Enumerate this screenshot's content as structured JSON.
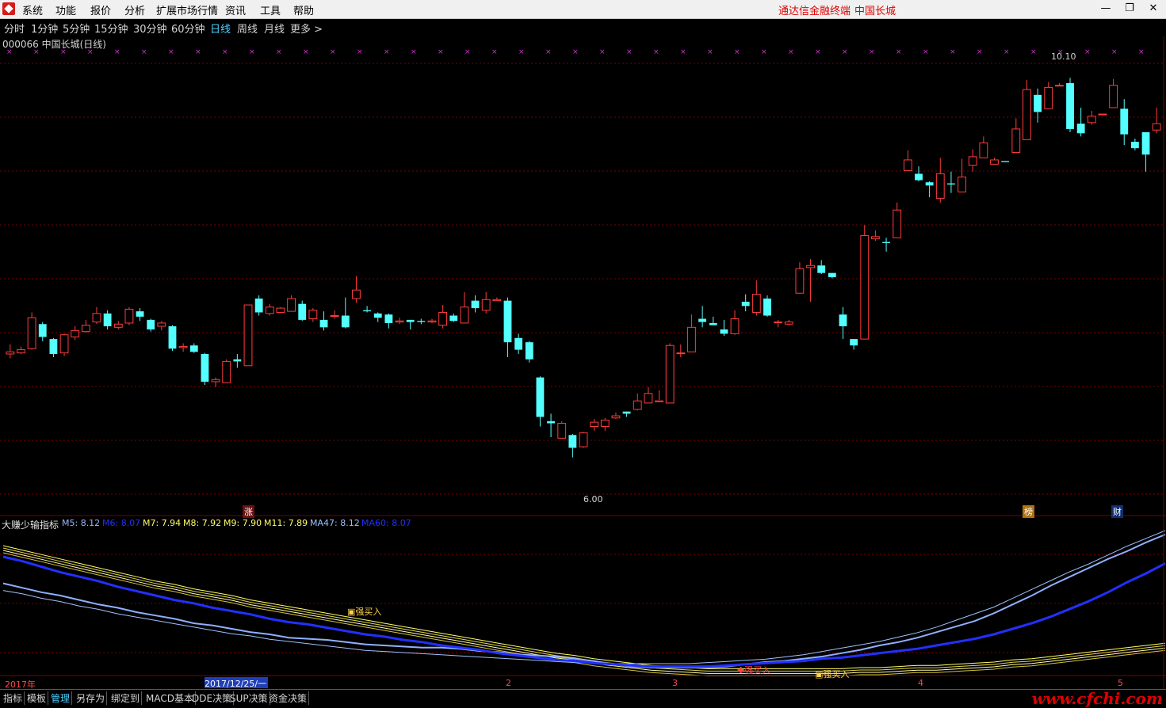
{
  "menu": {
    "items": [
      "系统",
      "功能",
      "报价",
      "分析",
      "扩展市场行情",
      "资讯",
      "工具",
      "帮助"
    ],
    "brand_left": "通达信金融终端",
    "brand_right": "中国长城"
  },
  "periods": [
    "分时",
    "1分钟",
    "5分钟",
    "15分钟",
    "30分钟",
    "60分钟",
    "日线",
    "周线",
    "月线",
    "更多 >"
  ],
  "active_period": "日线",
  "stock": {
    "title": "000066 中国长城(日线)",
    "high_label": "10.10",
    "low_label": "6.00",
    "zhang_tag": "涨",
    "bang_tag": "榜",
    "cai_tag": "财"
  },
  "indicator": {
    "name": "大赚少输指标",
    "values": [
      {
        "text": "M5: 8.12",
        "color": "#9db7ff"
      },
      {
        "text": "M6: 8.07",
        "color": "#2230ff"
      },
      {
        "text": "M7: 7.94",
        "color": "#ffff66"
      },
      {
        "text": "M8: 7.92",
        "color": "#ffff66"
      },
      {
        "text": "M9: 7.90",
        "color": "#ffff66"
      },
      {
        "text": "M11: 7.89",
        "color": "#ffff66"
      },
      {
        "text": "MA47: 8.12",
        "color": "#a0c0ff"
      },
      {
        "text": "MA60: 8.07",
        "color": "#2230ff"
      }
    ],
    "signal_1": "强买入",
    "signal_2": "强买入",
    "signal_3": "强买入"
  },
  "dates": {
    "year": "2017年",
    "selected": "2017/12/25/一",
    "m2": "2",
    "m3": "3",
    "m4": "4",
    "m5": "5"
  },
  "tabs": [
    "指标",
    "模板",
    "管理",
    "另存为",
    "绑定到",
    "MACD基本",
    "DDE决策",
    "SUP决策",
    "资金决策"
  ],
  "active_tab": "管理",
  "watermark": "www.cfchi.com",
  "colors": {
    "up": "#ff3c3c",
    "down": "#54ffff",
    "grid": "#7a0000"
  },
  "chart_data": {
    "type": "candlestick",
    "price_range": [
      6.0,
      10.1
    ],
    "candles": [
      [
        7.3,
        7.32,
        7.26,
        7.39
      ],
      [
        7.31,
        7.34,
        7.3,
        7.37
      ],
      [
        7.35,
        7.64,
        7.34,
        7.69
      ],
      [
        7.58,
        7.46,
        7.42,
        7.6
      ],
      [
        7.44,
        7.3,
        7.27,
        7.45
      ],
      [
        7.31,
        7.48,
        7.28,
        7.49
      ],
      [
        7.46,
        7.52,
        7.43,
        7.56
      ],
      [
        7.51,
        7.57,
        7.5,
        7.62
      ],
      [
        7.6,
        7.68,
        7.58,
        7.74
      ],
      [
        7.68,
        7.56,
        7.53,
        7.71
      ],
      [
        7.55,
        7.58,
        7.53,
        7.61
      ],
      [
        7.59,
        7.72,
        7.57,
        7.74
      ],
      [
        7.7,
        7.65,
        7.61,
        7.73
      ],
      [
        7.62,
        7.53,
        7.51,
        7.63
      ],
      [
        7.56,
        7.59,
        7.52,
        7.61
      ],
      [
        7.56,
        7.35,
        7.33,
        7.57
      ],
      [
        7.36,
        7.37,
        7.32,
        7.4
      ],
      [
        7.38,
        7.32,
        7.31,
        7.4
      ],
      [
        7.3,
        7.04,
        7.01,
        7.31
      ],
      [
        7.04,
        7.06,
        6.99,
        7.08
      ],
      [
        7.03,
        7.23,
        7.03,
        7.25
      ],
      [
        7.25,
        7.23,
        7.17,
        7.3
      ],
      [
        7.19,
        7.76,
        7.19,
        7.76
      ],
      [
        7.82,
        7.69,
        7.66,
        7.85
      ],
      [
        7.68,
        7.74,
        7.66,
        7.77
      ],
      [
        7.69,
        7.73,
        7.69,
        7.74
      ],
      [
        7.7,
        7.82,
        7.75,
        7.85
      ],
      [
        7.77,
        7.62,
        7.61,
        7.8
      ],
      [
        7.63,
        7.71,
        7.6,
        7.73
      ],
      [
        7.62,
        7.55,
        7.52,
        7.7
      ],
      [
        7.66,
        7.66,
        7.63,
        7.71
      ],
      [
        7.66,
        7.55,
        7.54,
        7.83
      ],
      [
        7.82,
        7.9,
        7.78,
        8.03
      ],
      [
        7.71,
        7.7,
        7.69,
        7.75
      ],
      [
        7.68,
        7.64,
        7.6,
        7.69
      ],
      [
        7.67,
        7.59,
        7.54,
        7.68
      ],
      [
        7.6,
        7.61,
        7.58,
        7.64
      ],
      [
        7.62,
        7.6,
        7.53,
        7.62
      ],
      [
        7.61,
        7.6,
        7.58,
        7.63
      ],
      [
        7.6,
        7.61,
        7.59,
        7.63
      ],
      [
        7.57,
        7.69,
        7.54,
        7.76
      ],
      [
        7.66,
        7.61,
        7.6,
        7.68
      ],
      [
        7.59,
        7.74,
        7.59,
        7.88
      ],
      [
        7.8,
        7.73,
        7.69,
        7.85
      ],
      [
        7.71,
        7.81,
        7.68,
        7.88
      ],
      [
        7.8,
        7.81,
        7.81,
        7.83
      ],
      [
        7.8,
        7.41,
        7.27,
        7.83
      ],
      [
        7.45,
        7.34,
        7.3,
        7.49
      ],
      [
        7.41,
        7.25,
        7.22,
        7.42
      ],
      [
        7.08,
        6.71,
        6.62,
        7.09
      ],
      [
        6.67,
        6.65,
        6.52,
        6.74
      ],
      [
        6.51,
        6.65,
        6.52,
        6.67
      ],
      [
        6.54,
        6.42,
        6.33,
        6.55
      ],
      [
        6.43,
        6.56,
        6.42,
        6.57
      ],
      [
        6.62,
        6.66,
        6.58,
        6.69
      ],
      [
        6.62,
        6.68,
        6.58,
        6.7
      ],
      [
        6.7,
        6.72,
        6.69,
        6.75
      ],
      [
        6.76,
        6.74,
        6.71,
        6.76
      ],
      [
        6.78,
        6.86,
        6.77,
        6.93
      ],
      [
        6.84,
        6.93,
        6.85,
        6.99
      ],
      [
        6.86,
        6.86,
        6.87,
        6.96
      ],
      [
        6.84,
        7.38,
        6.84,
        7.4
      ],
      [
        7.31,
        7.31,
        7.27,
        7.39
      ],
      [
        7.32,
        7.55,
        7.32,
        7.67
      ],
      [
        7.63,
        7.6,
        7.55,
        7.75
      ],
      [
        7.59,
        7.57,
        7.58,
        7.65
      ],
      [
        7.53,
        7.49,
        7.47,
        7.62
      ],
      [
        7.49,
        7.63,
        7.48,
        7.71
      ],
      [
        7.79,
        7.75,
        7.7,
        7.86
      ],
      [
        7.69,
        7.86,
        7.66,
        7.99
      ],
      [
        7.82,
        7.66,
        7.65,
        7.85
      ],
      [
        7.6,
        7.6,
        7.55,
        7.62
      ],
      [
        7.58,
        7.6,
        7.57,
        7.62
      ],
      [
        7.87,
        8.1,
        7.87,
        8.16
      ],
      [
        8.11,
        8.13,
        7.79,
        8.19
      ],
      [
        8.13,
        8.06,
        8.05,
        8.18
      ],
      [
        8.06,
        8.02,
        8.01,
        8.05
      ],
      [
        7.67,
        7.56,
        7.44,
        7.74
      ],
      [
        7.44,
        7.38,
        7.34,
        7.44
      ],
      [
        7.44,
        8.41,
        7.44,
        8.51
      ],
      [
        8.38,
        8.4,
        8.36,
        8.46
      ],
      [
        8.35,
        8.34,
        8.26,
        8.39
      ],
      [
        8.39,
        8.65,
        8.39,
        8.72
      ],
      [
        9.02,
        9.12,
        9.02,
        9.21
      ],
      [
        8.99,
        8.93,
        8.92,
        9.06
      ],
      [
        8.91,
        8.88,
        8.77,
        8.92
      ],
      [
        8.76,
        8.99,
        8.72,
        9.14
      ],
      [
        8.9,
        8.89,
        8.81,
        9.01
      ],
      [
        8.82,
        8.96,
        8.82,
        9.13
      ],
      [
        9.07,
        9.15,
        9.01,
        9.22
      ],
      [
        9.14,
        9.28,
        9.21,
        9.34
      ],
      [
        9.08,
        9.12,
        9.14,
        9.1
      ],
      [
        9.11,
        9.1,
        9.12,
        9.12
      ],
      [
        9.19,
        9.41,
        9.2,
        9.51
      ],
      [
        9.31,
        9.78,
        9.31,
        9.87
      ],
      [
        9.73,
        9.57,
        9.47,
        9.79
      ],
      [
        9.6,
        9.8,
        9.6,
        9.85
      ],
      [
        9.82,
        9.82,
        9.82,
        9.84
      ],
      [
        9.84,
        9.41,
        9.38,
        9.89
      ],
      [
        9.46,
        9.37,
        9.34,
        9.61
      ],
      [
        9.47,
        9.53,
        9.45,
        9.58
      ],
      [
        9.55,
        9.55,
        9.57,
        9.57
      ],
      [
        9.61,
        9.82,
        9.62,
        9.88
      ],
      [
        9.6,
        9.36,
        9.26,
        9.69
      ],
      [
        9.29,
        9.23,
        9.21,
        9.32
      ],
      [
        9.38,
        9.17,
        9.01,
        9.38
      ],
      [
        9.4,
        9.46,
        9.37,
        9.61
      ]
    ],
    "indicator_lines": {
      "M5": [
        7.66,
        7.62,
        7.58,
        7.55,
        7.51,
        7.47,
        7.44,
        7.4,
        7.37,
        7.34,
        7.3,
        7.28,
        7.25,
        7.22,
        7.2,
        7.17,
        7.16,
        7.15,
        7.13,
        7.11,
        7.1,
        7.09,
        7.08,
        7.08,
        7.07,
        7.05,
        7.04,
        7.02,
        7.01,
        7.0,
        6.98,
        6.96,
        6.93,
        6.91,
        6.9,
        6.9,
        6.9,
        6.9,
        6.91,
        6.93,
        6.95,
        6.96,
        6.98,
        7.0,
        7.03,
        7.06,
        7.1,
        7.13,
        7.17,
        7.22,
        7.27,
        7.32,
        7.39,
        7.47,
        7.55,
        7.64,
        7.72,
        7.8,
        7.88,
        7.95,
        8.03,
        8.1
      ],
      "M6": [
        7.9,
        7.86,
        7.81,
        7.76,
        7.72,
        7.68,
        7.63,
        7.59,
        7.55,
        7.51,
        7.48,
        7.44,
        7.41,
        7.38,
        7.34,
        7.31,
        7.29,
        7.26,
        7.23,
        7.2,
        7.18,
        7.15,
        7.13,
        7.1,
        7.08,
        7.06,
        7.03,
        7.01,
        6.99,
        6.97,
        6.96,
        6.94,
        6.93,
        6.92,
        6.91,
        6.91,
        6.91,
        6.91,
        6.92,
        6.93,
        6.94,
        6.95,
        6.96,
        6.98,
        6.99,
        7.01,
        7.03,
        7.05,
        7.07,
        7.1,
        7.13,
        7.16,
        7.2,
        7.25,
        7.3,
        7.36,
        7.43,
        7.5,
        7.58,
        7.67,
        7.75,
        7.84
      ],
      "MA47": [
        7.56,
        7.53,
        7.49,
        7.46,
        7.42,
        7.39,
        7.35,
        7.32,
        7.29,
        7.26,
        7.23,
        7.2,
        7.17,
        7.15,
        7.12,
        7.1,
        7.08,
        7.06,
        7.04,
        7.02,
        7.01,
        7.0,
        6.99,
        6.98,
        6.97,
        6.96,
        6.95,
        6.94,
        6.93,
        6.92,
        6.91,
        6.91,
        6.9,
        6.9,
        6.9,
        6.9,
        6.9,
        6.91,
        6.92,
        6.93,
        6.94,
        6.96,
        6.98,
        7.01,
        7.04,
        7.07,
        7.1,
        7.14,
        7.18,
        7.23,
        7.29,
        7.35,
        7.41,
        7.49,
        7.57,
        7.65,
        7.73,
        7.8,
        7.88,
        7.96,
        8.03,
        8.1
      ],
      "M7": [
        8.0,
        7.96,
        7.92,
        7.88,
        7.84,
        7.8,
        7.76,
        7.72,
        7.68,
        7.65,
        7.61,
        7.58,
        7.55,
        7.51,
        7.48,
        7.45,
        7.42,
        7.39,
        7.36,
        7.33,
        7.3,
        7.27,
        7.24,
        7.21,
        7.18,
        7.15,
        7.12,
        7.09,
        7.06,
        7.03,
        7.01,
        6.98,
        6.96,
        6.94,
        6.92,
        6.91,
        6.9,
        6.89,
        6.89,
        6.89,
        6.89,
        6.89,
        6.89,
        6.89,
        6.89,
        6.9,
        6.9,
        6.91,
        6.92,
        6.92,
        6.93,
        6.94,
        6.95,
        6.97,
        6.98,
        7.0,
        7.02,
        7.04,
        7.06,
        7.08,
        7.1,
        7.12
      ]
    }
  }
}
